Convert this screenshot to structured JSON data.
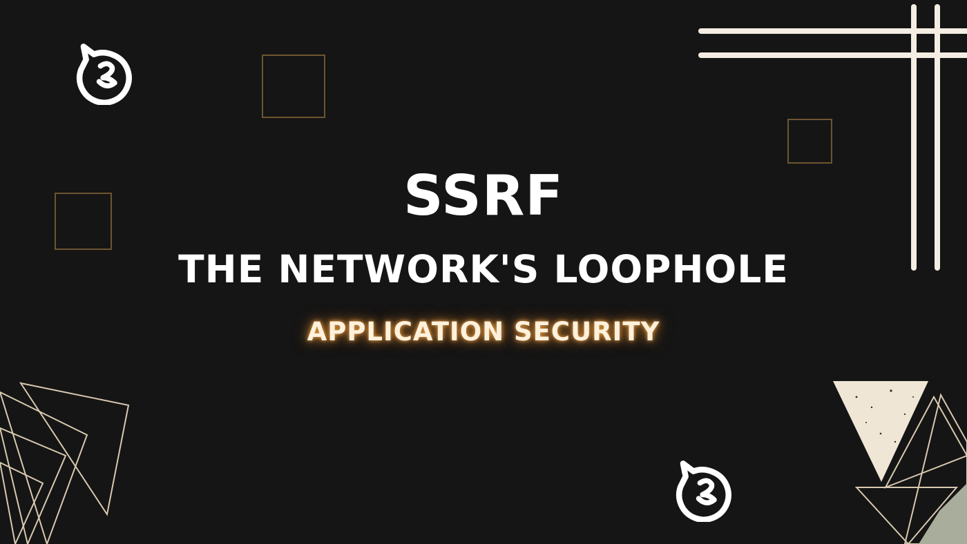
{
  "banner": {
    "title": "SSRF",
    "subtitle": "THE NETWORK'S LOOPHOLE",
    "tagline": "APPLICATION SECURITY"
  },
  "colors": {
    "background": "#151515",
    "text": "#ffffff",
    "tagline_glow": "#e8a24e",
    "outline_gold": "#6e5530",
    "line_cream": "#f4ede3",
    "triangle_cream": "#efe6d6",
    "triangle_sage": "#a9ad9b"
  },
  "icons": {
    "logo_top_left": "cat-logo-icon",
    "logo_bottom": "cat-logo-icon"
  }
}
